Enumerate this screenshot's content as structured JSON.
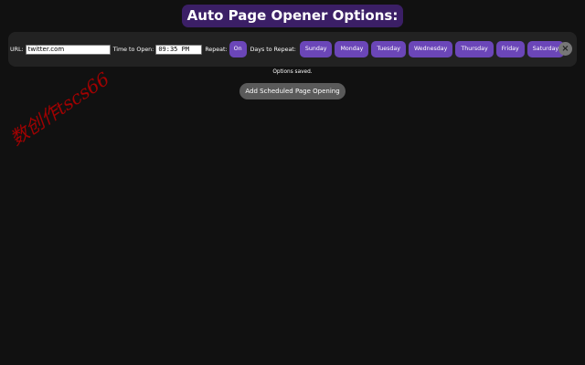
{
  "header": {
    "title": "Auto Page Opener Options:",
    "title_bg": "#3b1f66"
  },
  "schedule": {
    "url_label": "URL:",
    "url_value": "twitter.com",
    "time_label": "Time to Open:",
    "time_value": "09:35 PM",
    "repeat_label": "Repeat:",
    "repeat_toggle": "On",
    "days_label": "Days to Repeat:",
    "days": [
      {
        "label": "Sunday"
      },
      {
        "label": "Monday"
      },
      {
        "label": "Tuesday"
      },
      {
        "label": "Wednesday"
      },
      {
        "label": "Thursday"
      },
      {
        "label": "Friday"
      },
      {
        "label": "Saturday"
      }
    ],
    "remove_icon": "×",
    "accent_color": "#6b46b8"
  },
  "status": {
    "message": "Options saved."
  },
  "actions": {
    "add_label": "Add Scheduled Page Opening"
  },
  "watermark": {
    "text": "数创作tscs66"
  }
}
